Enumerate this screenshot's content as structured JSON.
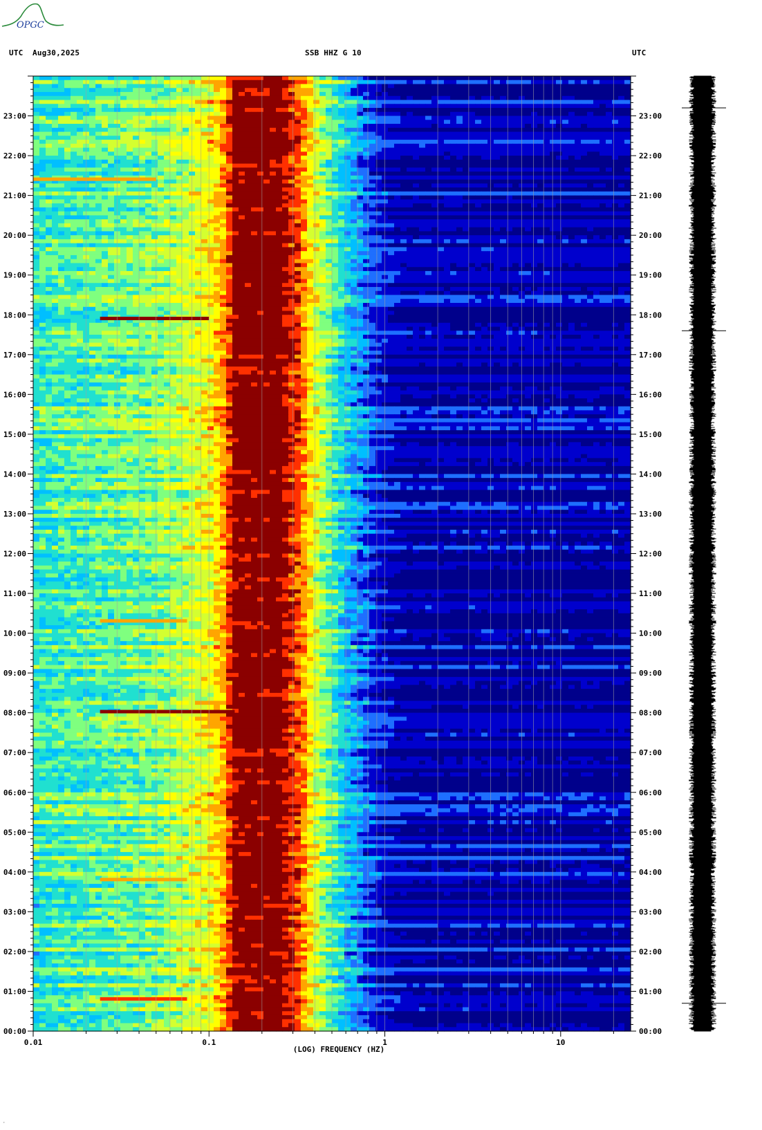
{
  "logo": {
    "text": "OPGC",
    "color": "#2a8a3a"
  },
  "header": {
    "left_tz": "UTC",
    "date": "Aug30,2025",
    "station": "SSB HHZ G 10",
    "right_tz": "UTC"
  },
  "footer_mark": "·",
  "chart_data": {
    "type": "heatmap",
    "title": "SSB HHZ G 10",
    "xlabel": "(LOG) FREQUENCY (HZ)",
    "x_scale": "log",
    "xlim": [
      0.01,
      25
    ],
    "x_ticks": [
      {
        "value": 0.01,
        "label": "0.01"
      },
      {
        "value": 0.1,
        "label": "0.1"
      },
      {
        "value": 1,
        "label": "1"
      },
      {
        "value": 10,
        "label": "10"
      }
    ],
    "y_unit": "hour (UTC)",
    "ylim": [
      0,
      24
    ],
    "y_ticks": [
      {
        "value": 0,
        "label": "00:00"
      },
      {
        "value": 1,
        "label": "01:00"
      },
      {
        "value": 2,
        "label": "02:00"
      },
      {
        "value": 3,
        "label": "03:00"
      },
      {
        "value": 4,
        "label": "04:00"
      },
      {
        "value": 5,
        "label": "05:00"
      },
      {
        "value": 6,
        "label": "06:00"
      },
      {
        "value": 7,
        "label": "07:00"
      },
      {
        "value": 8,
        "label": "08:00"
      },
      {
        "value": 9,
        "label": "09:00"
      },
      {
        "value": 10,
        "label": "10:00"
      },
      {
        "value": 11,
        "label": "11:00"
      },
      {
        "value": 12,
        "label": "12:00"
      },
      {
        "value": 13,
        "label": "13:00"
      },
      {
        "value": 14,
        "label": "14:00"
      },
      {
        "value": 15,
        "label": "15:00"
      },
      {
        "value": 16,
        "label": "16:00"
      },
      {
        "value": 17,
        "label": "17:00"
      },
      {
        "value": 18,
        "label": "18:00"
      },
      {
        "value": 19,
        "label": "19:00"
      },
      {
        "value": 20,
        "label": "20:00"
      },
      {
        "value": 21,
        "label": "21:00"
      },
      {
        "value": 22,
        "label": "22:00"
      },
      {
        "value": 23,
        "label": "23:00"
      }
    ],
    "colormap": [
      "#00008b",
      "#0000cd",
      "#1e6fff",
      "#00bfff",
      "#20e0d0",
      "#7fff7f",
      "#d4ff30",
      "#ffff00",
      "#ffa500",
      "#ff3000",
      "#8b0000"
    ],
    "spectrum_profile": [
      {
        "f": 0.01,
        "level": 0.42
      },
      {
        "f": 0.024,
        "level": 0.47
      },
      {
        "f": 0.05,
        "level": 0.52
      },
      {
        "f": 0.075,
        "level": 0.6
      },
      {
        "f": 0.1,
        "level": 0.68
      },
      {
        "f": 0.12,
        "level": 0.8
      },
      {
        "f": 0.14,
        "level": 0.99
      },
      {
        "f": 0.25,
        "level": 1.0
      },
      {
        "f": 0.32,
        "level": 0.9
      },
      {
        "f": 0.42,
        "level": 0.6
      },
      {
        "f": 0.6,
        "level": 0.34
      },
      {
        "f": 0.9,
        "level": 0.14
      },
      {
        "f": 1.3,
        "level": 0.07
      },
      {
        "f": 25,
        "level": 0.06
      }
    ],
    "transient_events": [
      {
        "hour": 17.9,
        "f_start": 0.024,
        "f_end": 0.1,
        "level": 0.98
      },
      {
        "hour": 8.02,
        "f_start": 0.024,
        "f_end": 0.14,
        "level": 0.95
      },
      {
        "hour": 0.8,
        "f_start": 0.024,
        "f_end": 0.075,
        "level": 0.85
      },
      {
        "hour": 21.4,
        "f_start": 0.01,
        "f_end": 0.05,
        "level": 0.75
      },
      {
        "hour": 10.3,
        "f_start": 0.024,
        "f_end": 0.075,
        "level": 0.8
      },
      {
        "hour": 3.8,
        "f_start": 0.024,
        "f_end": 0.075,
        "level": 0.78
      }
    ],
    "gridline_freqs": [
      0.02,
      0.03,
      0.04,
      0.05,
      0.06,
      0.07,
      0.08,
      0.09,
      0.2,
      0.3,
      0.4,
      0.5,
      0.6,
      0.7,
      0.8,
      0.9,
      2,
      3,
      4,
      5,
      6,
      7,
      8,
      9,
      20
    ],
    "seismogram": {
      "hours": [
        0,
        24
      ],
      "marks": [
        23.2,
        17.6,
        0.7
      ]
    }
  }
}
